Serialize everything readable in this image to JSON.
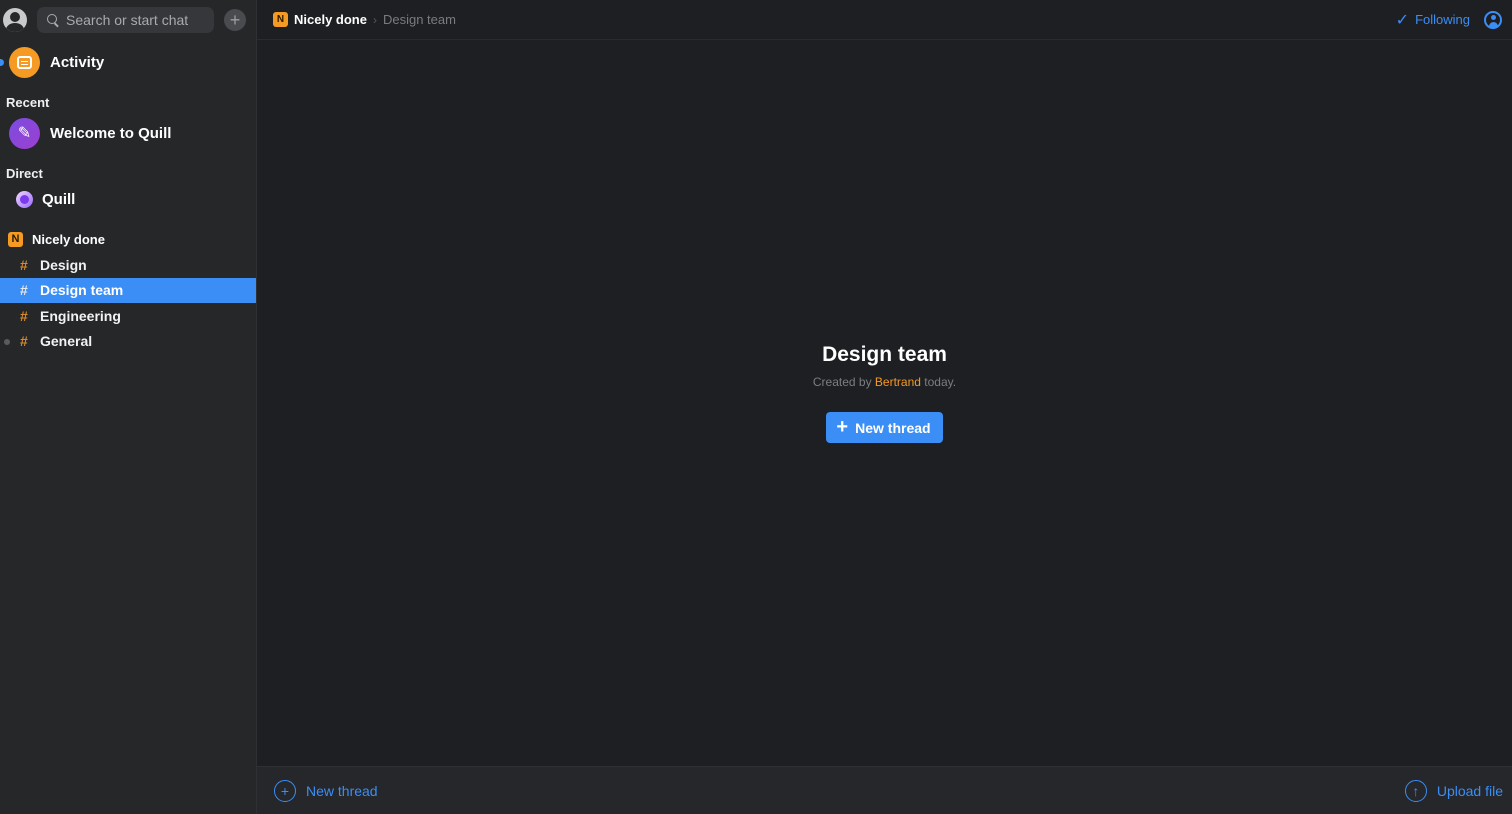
{
  "sidebar": {
    "search_placeholder": "Search or start chat",
    "add_label": "+",
    "activity_label": "Activity",
    "recent_title": "Recent",
    "recent_items": [
      {
        "label": "Welcome to Quill"
      }
    ],
    "direct_title": "Direct",
    "direct_items": [
      {
        "label": "Quill"
      }
    ],
    "workspace": {
      "badge": "N",
      "name": "Nicely done",
      "channels": [
        {
          "label": "Design",
          "active": false
        },
        {
          "label": "Design team",
          "active": true
        },
        {
          "label": "Engineering",
          "active": false
        },
        {
          "label": "General",
          "active": false,
          "unread": true
        }
      ]
    }
  },
  "topbar": {
    "workspace_badge": "N",
    "workspace_name": "Nicely done",
    "separator": "›",
    "channel_name": "Design team",
    "following_label": "Following"
  },
  "center": {
    "title": "Design team",
    "created_prefix": "Created by",
    "author": "Bertrand",
    "created_suffix": "today.",
    "button_label": "New thread"
  },
  "bottombar": {
    "new_thread_label": "New thread",
    "upload_label": "Upload file"
  },
  "colors": {
    "accent": "#3a8ef6",
    "orange": "#f59a23",
    "background": "#1e1f22",
    "sidebar": "#262729"
  }
}
